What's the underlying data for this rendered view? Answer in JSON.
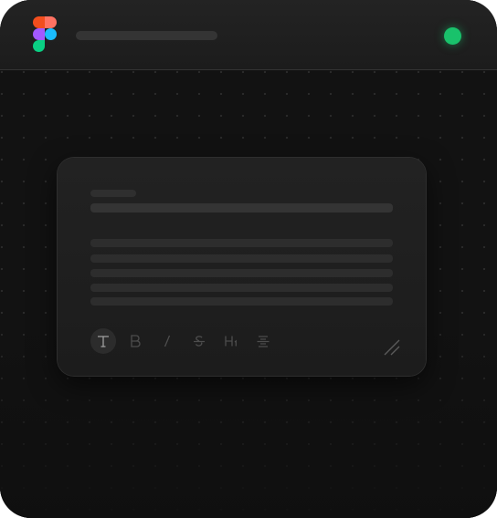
{
  "app": {
    "logo_icon": "figma-logo-icon",
    "status_color": "#19c26b"
  },
  "editor": {
    "toolbar": [
      {
        "icon": "text-icon",
        "glyph": "T",
        "active": true
      },
      {
        "icon": "bold-icon",
        "glyph": "B",
        "active": false
      },
      {
        "icon": "italic-icon",
        "glyph": "I",
        "active": false
      },
      {
        "icon": "strikethrough-icon",
        "glyph": "S",
        "active": false
      },
      {
        "icon": "heading-icon",
        "glyph": "H",
        "active": false
      },
      {
        "icon": "align-icon",
        "glyph": "≡",
        "active": false
      }
    ],
    "resize_icon": "resize-handle-icon"
  }
}
